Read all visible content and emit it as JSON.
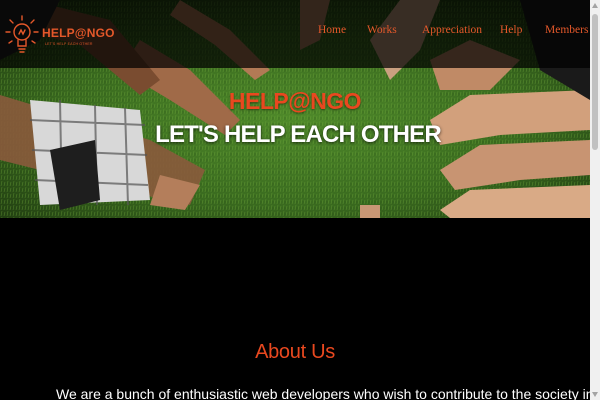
{
  "brand": {
    "name": "HELP@NGO",
    "tagline": "LET'S HELP EACH OTHER",
    "accent_color": "#e4582a"
  },
  "nav": {
    "items": [
      {
        "label": "Home"
      },
      {
        "label": "Works"
      },
      {
        "label": "Appreciation"
      },
      {
        "label": "Help"
      },
      {
        "label": "Members"
      }
    ]
  },
  "hero": {
    "title": "HELP@NGO",
    "subtitle": "LET'S HELP EACH OTHER",
    "image_description_icon": "hands-and-feet-circle-on-grass-image"
  },
  "about": {
    "title": "About Us",
    "text": "We are a bunch of enthusiastic web developers who wish to contribute to the society in our own way. Through"
  }
}
